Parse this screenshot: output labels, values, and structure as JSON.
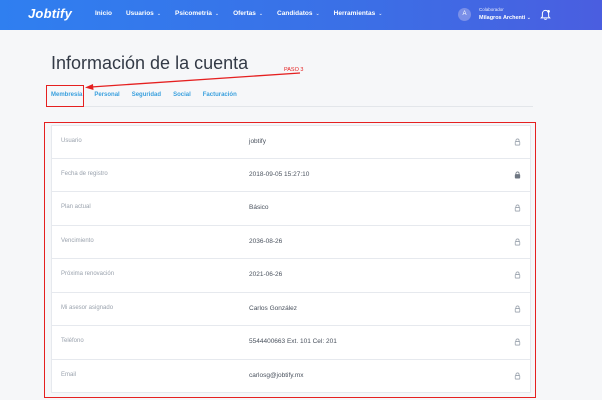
{
  "app": {
    "logo_text": "Jobtify"
  },
  "nav": {
    "items": [
      {
        "label": "Inicio",
        "dropdown": false
      },
      {
        "label": "Usuarios",
        "dropdown": true
      },
      {
        "label": "Psicometría",
        "dropdown": true
      },
      {
        "label": "Ofertas",
        "dropdown": true
      },
      {
        "label": "Candidatos",
        "dropdown": true
      },
      {
        "label": "Herramientas",
        "dropdown": true
      }
    ]
  },
  "user": {
    "avatar_letter": "A",
    "role": "Colaborador",
    "name": "Milagros Archenti"
  },
  "page": {
    "title": "Información de la cuenta"
  },
  "tabs": [
    {
      "label": "Membresía",
      "active": true
    },
    {
      "label": "Personal"
    },
    {
      "label": "Seguridad"
    },
    {
      "label": "Social"
    },
    {
      "label": "Facturación"
    }
  ],
  "annotation": {
    "step_label": "PASO 3",
    "color": "#e52020"
  },
  "account_info": [
    {
      "label": "Usuario",
      "value": "jobtify",
      "icon": "lock-icon"
    },
    {
      "label": "Fecha de registro",
      "value": "2018-09-05 15:27:10",
      "icon": "lock-icon"
    },
    {
      "label": "Plan actual",
      "value": "Básico",
      "icon": "lock-icon"
    },
    {
      "label": "Vencimiento",
      "value": "2036-08-26",
      "icon": "lock-icon"
    },
    {
      "label": "Próxima renovación",
      "value": "2021-06-26",
      "icon": "lock-icon"
    },
    {
      "label": "Mi asesor asignado",
      "value": "Carlos González",
      "icon": "lock-icon"
    },
    {
      "label": "Teléfono",
      "value": "5544400663 Ext. 101 Cel: 201",
      "icon": "lock-icon"
    },
    {
      "label": "Email",
      "value": "carlosg@jobtify.mx",
      "icon": "lock-icon"
    }
  ],
  "colors": {
    "accent": "#3aa0de",
    "topbar": "#3b6fe6",
    "annotation": "#e52020"
  }
}
